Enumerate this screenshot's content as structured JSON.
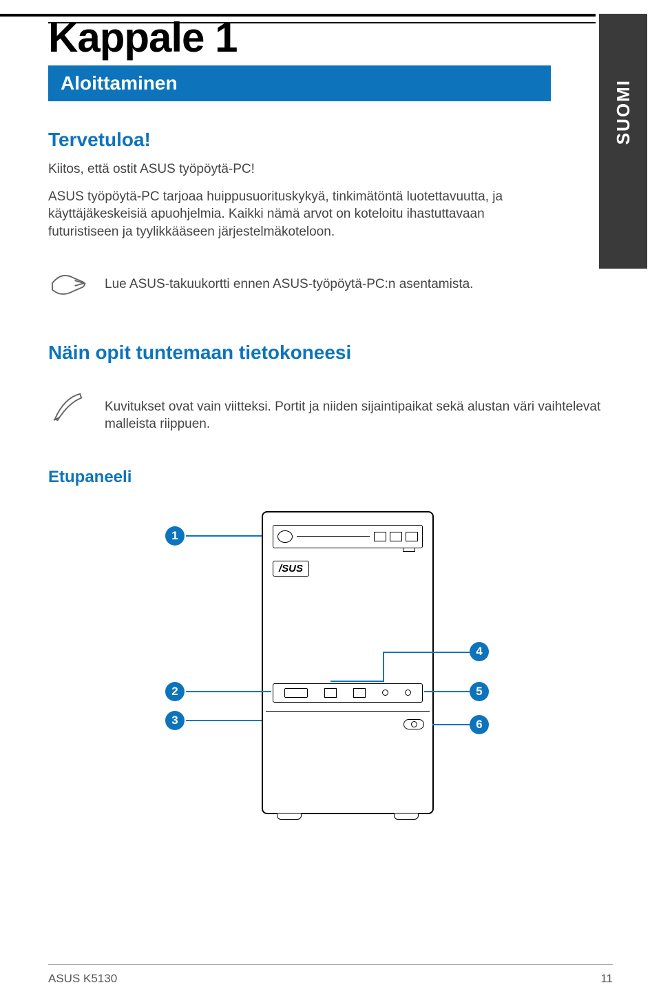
{
  "side_tab": "SUOMI",
  "chapter": "Kappale 1",
  "subtitle": "Aloittaminen",
  "welcome_h": "Tervetuloa!",
  "welcome_p1": "Kiitos, että ostit ASUS työpöytä-PC!",
  "welcome_p2": "ASUS työpöytä-PC tarjoaa huippusuorituskykyä, tinkimätöntä luotettavuutta, ja käyttäjäkeskeisiä apuohjelmia. Kaikki nämä arvot on koteloitu ihastuttavaan futuristiseen ja tyylikkääseen järjestelmäkoteloon.",
  "note1": "Lue ASUS-takuukortti ennen ASUS-työpöytä-PC:n asentamista.",
  "section_h": "Näin opit tuntemaan tietokoneesi",
  "note2": "Kuvitukset ovat vain viitteksi. Portit ja niiden sijaintipaikat sekä alustan väri vaihtelevat malleista riippuen.",
  "section_sub": "Etupaneeli",
  "brand": "/SUS",
  "callouts": {
    "c1": "1",
    "c2": "2",
    "c3": "3",
    "c4": "4",
    "c5": "5",
    "c6": "6"
  },
  "footer_left": "ASUS K5130",
  "footer_right": "11"
}
